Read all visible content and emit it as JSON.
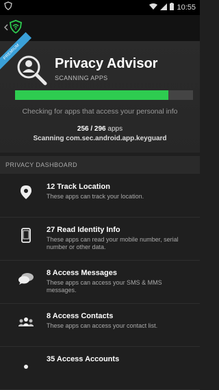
{
  "status_bar": {
    "time": "10:55"
  },
  "hero": {
    "badge": "PREMIUM",
    "title": "Privacy Advisor",
    "subtitle": "SCANNING APPS",
    "progress_fraction": 0.86,
    "checking_text": "Checking for apps that access your personal info",
    "count_text": "256 / 296",
    "count_suffix": "apps",
    "scanning_text": "Scanning com.sec.android.app.keyguard"
  },
  "section_header": "PRIVACY DASHBOARD",
  "items": [
    {
      "title": "12 Track Location",
      "desc": "These apps can track your location.",
      "icon": "location-pin-icon"
    },
    {
      "title": "27 Read Identity Info",
      "desc": "These apps can read your mobile number, serial number or other data.",
      "icon": "phone-icon"
    },
    {
      "title": "8 Access Messages",
      "desc": "These apps can access your SMS & MMS messages.",
      "icon": "chat-bubbles-icon"
    },
    {
      "title": "8 Access Contacts",
      "desc": "These apps can access your contact list.",
      "icon": "contacts-group-icon"
    },
    {
      "title": "35 Access Accounts",
      "desc": "",
      "icon": "accounts-icon"
    }
  ],
  "colors": {
    "accent_green": "#2ecc50",
    "badge_blue": "#3aa0d8"
  }
}
